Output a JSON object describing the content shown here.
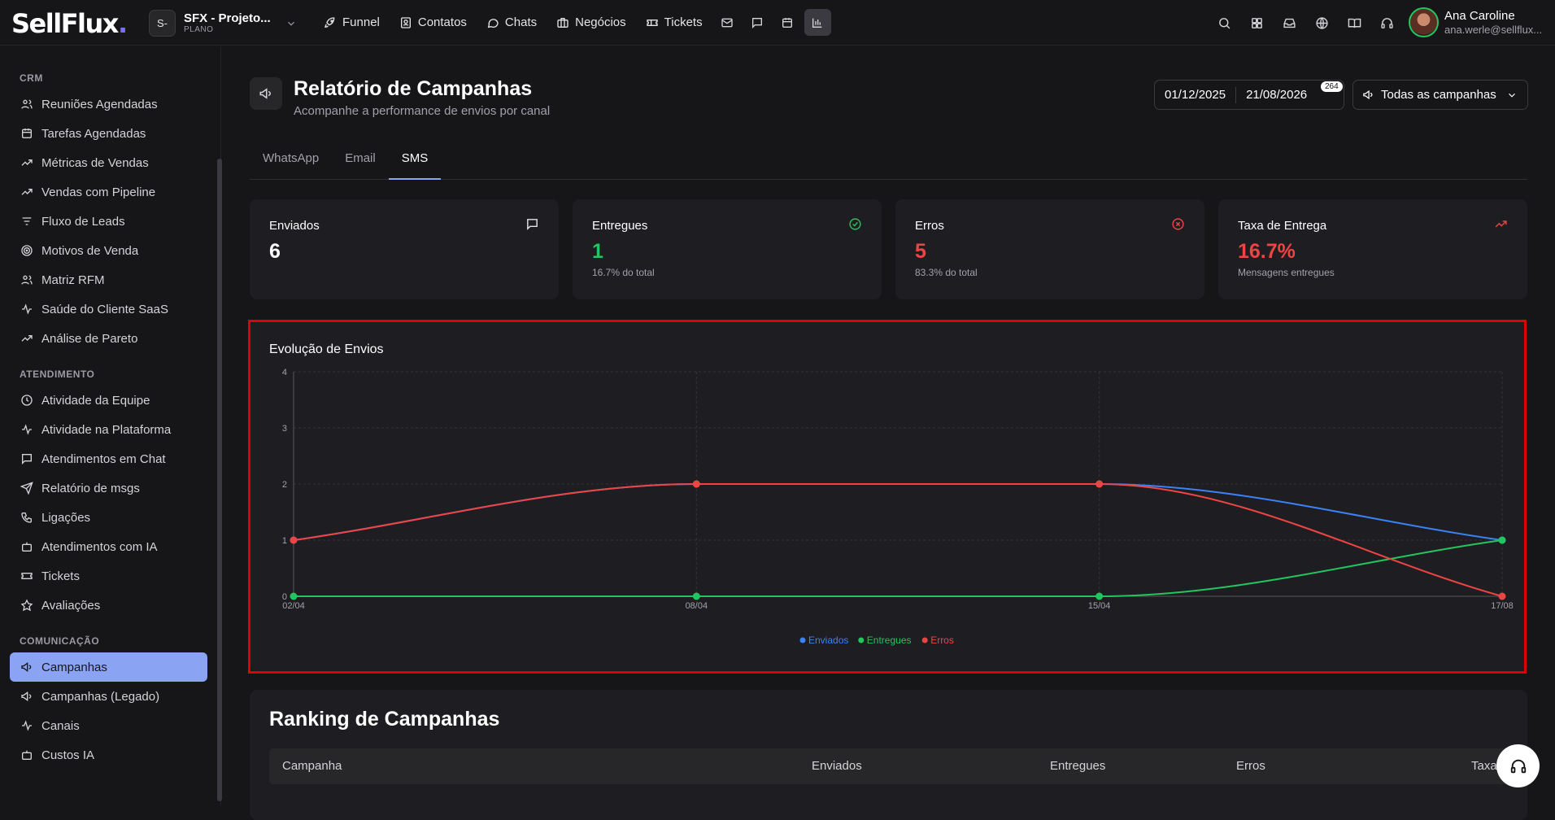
{
  "brand": {
    "logo_text": "SellFlux",
    "logo_dot": "."
  },
  "project": {
    "badge": "S-",
    "name": "SFX - Projeto...",
    "plan": "PLANO"
  },
  "nav": {
    "funnel": "Funnel",
    "contatos": "Contatos",
    "chats": "Chats",
    "negocios": "Negócios",
    "tickets": "Tickets"
  },
  "user": {
    "name": "Ana Caroline",
    "email": "ana.werle@sellflux..."
  },
  "sidebar": {
    "crm_title": "CRM",
    "crm_items": [
      "Reuniões Agendadas",
      "Tarefas Agendadas",
      "Métricas de Vendas",
      "Vendas com Pipeline",
      "Fluxo de Leads",
      "Motivos de Venda",
      "Matriz RFM",
      "Saúde do Cliente SaaS",
      "Análise de Pareto"
    ],
    "atend_title": "ATENDIMENTO",
    "atend_items": [
      "Atividade da Equipe",
      "Atividade na Plataforma",
      "Atendimentos em Chat",
      "Relatório de msgs",
      "Ligações",
      "Atendimentos com IA",
      "Tickets",
      "Avaliações"
    ],
    "com_title": "COMUNICAÇÃO",
    "com_items": [
      "Campanhas",
      "Campanhas (Legado)",
      "Canais",
      "Custos IA"
    ]
  },
  "page": {
    "title": "Relatório de Campanhas",
    "subtitle": "Acompanhe a performance de envios por canal"
  },
  "filters": {
    "date_start": "01/12/2025",
    "date_end": "21/08/2026",
    "badge": "264",
    "campaign_select": "Todas as campanhas"
  },
  "tabs": [
    "WhatsApp",
    "Email",
    "SMS"
  ],
  "active_tab": "SMS",
  "cards": [
    {
      "label": "Enviados",
      "value": "6",
      "sub": ""
    },
    {
      "label": "Entregues",
      "value": "1",
      "sub": "16.7% do total"
    },
    {
      "label": "Erros",
      "value": "5",
      "sub": "83.3% do total"
    },
    {
      "label": "Taxa de Entrega",
      "value": "16.7%",
      "sub": "Mensagens entregues"
    }
  ],
  "colors": {
    "accent": "#8aa3f2",
    "enviados": "#3b82f6",
    "entregues": "#22c55e",
    "erros": "#ef4444"
  },
  "chart_data": {
    "type": "line",
    "title": "Evolução de Envios",
    "x": [
      "02/04",
      "08/04",
      "15/04",
      "17/08"
    ],
    "ylim": [
      0,
      4
    ],
    "y_ticks": [
      "0",
      "1",
      "2",
      "3",
      "4"
    ],
    "grid": true,
    "legend_position": "bottom-center",
    "series": [
      {
        "name": "Enviados",
        "values": [
          1,
          2,
          2,
          1
        ],
        "color": "#3b82f6"
      },
      {
        "name": "Entregues",
        "values": [
          0,
          0,
          0,
          1
        ],
        "color": "#22c55e"
      },
      {
        "name": "Erros",
        "values": [
          1,
          2,
          2,
          0
        ],
        "color": "#ef4444"
      }
    ]
  },
  "ranking": {
    "title": "Ranking de Campanhas",
    "columns": [
      "Campanha",
      "Enviados",
      "Entregues",
      "Erros",
      "Taxa"
    ]
  }
}
